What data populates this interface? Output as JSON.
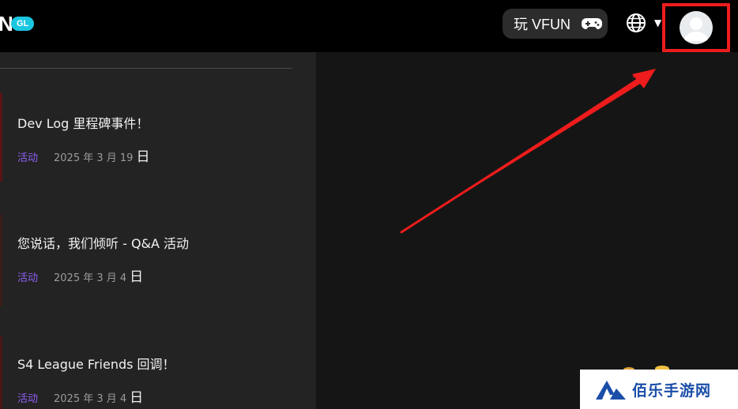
{
  "header": {
    "logo_tail": "N",
    "region_badge": "GL",
    "play_button_label": "玩 VFUN",
    "language_icon": "globe-icon",
    "language_caret": "▼",
    "profile_icon": "user-avatar-icon"
  },
  "articles": [
    {
      "title": "Dev Log 里程碑事件！",
      "tag": "活动",
      "date": "2025 年 3 月 19",
      "day": "日"
    },
    {
      "title": "您说话，我们倾听 - Q&A 活动",
      "tag": "活动",
      "date": "2025 年 3 月 4",
      "day": "日"
    },
    {
      "title": "S4 League Friends 回调！",
      "tag": "活动",
      "date": "2025 年 3 月 4",
      "day": "日"
    }
  ],
  "watermark": {
    "text": "佰乐手游网"
  },
  "colors": {
    "accent_purple": "#8f5ef5",
    "badge_cyan": "#19c7e0",
    "annotation_red": "#ee1c1c",
    "watermark_blue": "#1a4ea8"
  }
}
